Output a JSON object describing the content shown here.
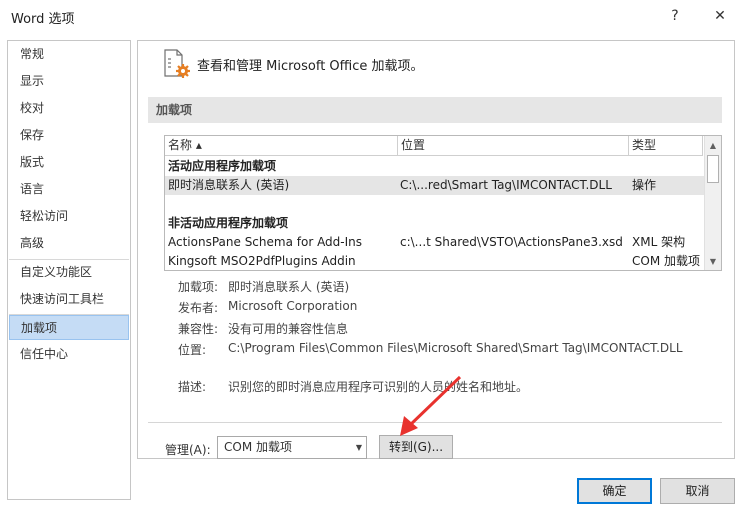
{
  "window": {
    "title": "Word 选项",
    "help": "?",
    "close": "✕"
  },
  "sidebar": {
    "items": [
      {
        "label": "常规"
      },
      {
        "label": "显示"
      },
      {
        "label": "校对"
      },
      {
        "label": "保存"
      },
      {
        "label": "版式"
      },
      {
        "label": "语言"
      },
      {
        "label": "轻松访问"
      },
      {
        "label": "高级"
      },
      {
        "label": "自定义功能区"
      },
      {
        "label": "快速访问工具栏"
      },
      {
        "label": "加载项"
      },
      {
        "label": "信任中心"
      }
    ],
    "selected": "加载项"
  },
  "header": {
    "text": "查看和管理 Microsoft Office 加载项。"
  },
  "section": {
    "title": "加载项"
  },
  "list": {
    "columns": {
      "name": "名称 ▴",
      "location": "位置",
      "type": "类型"
    },
    "group_active": "活动应用程序加载项",
    "active_rows": [
      {
        "name": "即时消息联系人 (英语)",
        "location": "C:\\...red\\Smart Tag\\IMCONTACT.DLL",
        "type": "操作"
      }
    ],
    "group_inactive": "非活动应用程序加载项",
    "inactive_rows": [
      {
        "name": "ActionsPane Schema for Add-Ins",
        "location": "c:\\...t Shared\\VSTO\\ActionsPane3.xsd",
        "type": "XML 架构"
      },
      {
        "name": "Kingsoft MSO2PdfPlugins Addin",
        "location": "",
        "type": "COM 加载项"
      }
    ]
  },
  "details": {
    "addin_label": "加载项:",
    "addin_value": "即时消息联系人 (英语)",
    "publisher_label": "发布者:",
    "publisher_value": "Microsoft Corporation",
    "compat_label": "兼容性:",
    "compat_value": "没有可用的兼容性信息",
    "location_label": "位置:",
    "location_value": "C:\\Program Files\\Common Files\\Microsoft Shared\\Smart Tag\\IMCONTACT.DLL",
    "desc_label": "描述:",
    "desc_value": "识别您的即时消息应用程序可识别的人员的姓名和地址。"
  },
  "manage": {
    "label": "管理(A):",
    "selected": "COM 加载项",
    "go": "转到(G)..."
  },
  "footer": {
    "ok": "确定",
    "cancel": "取消"
  },
  "colors": {
    "selected_bg": "#c5dcf5",
    "accent": "#0078d7",
    "arrow": "#e8322e"
  }
}
